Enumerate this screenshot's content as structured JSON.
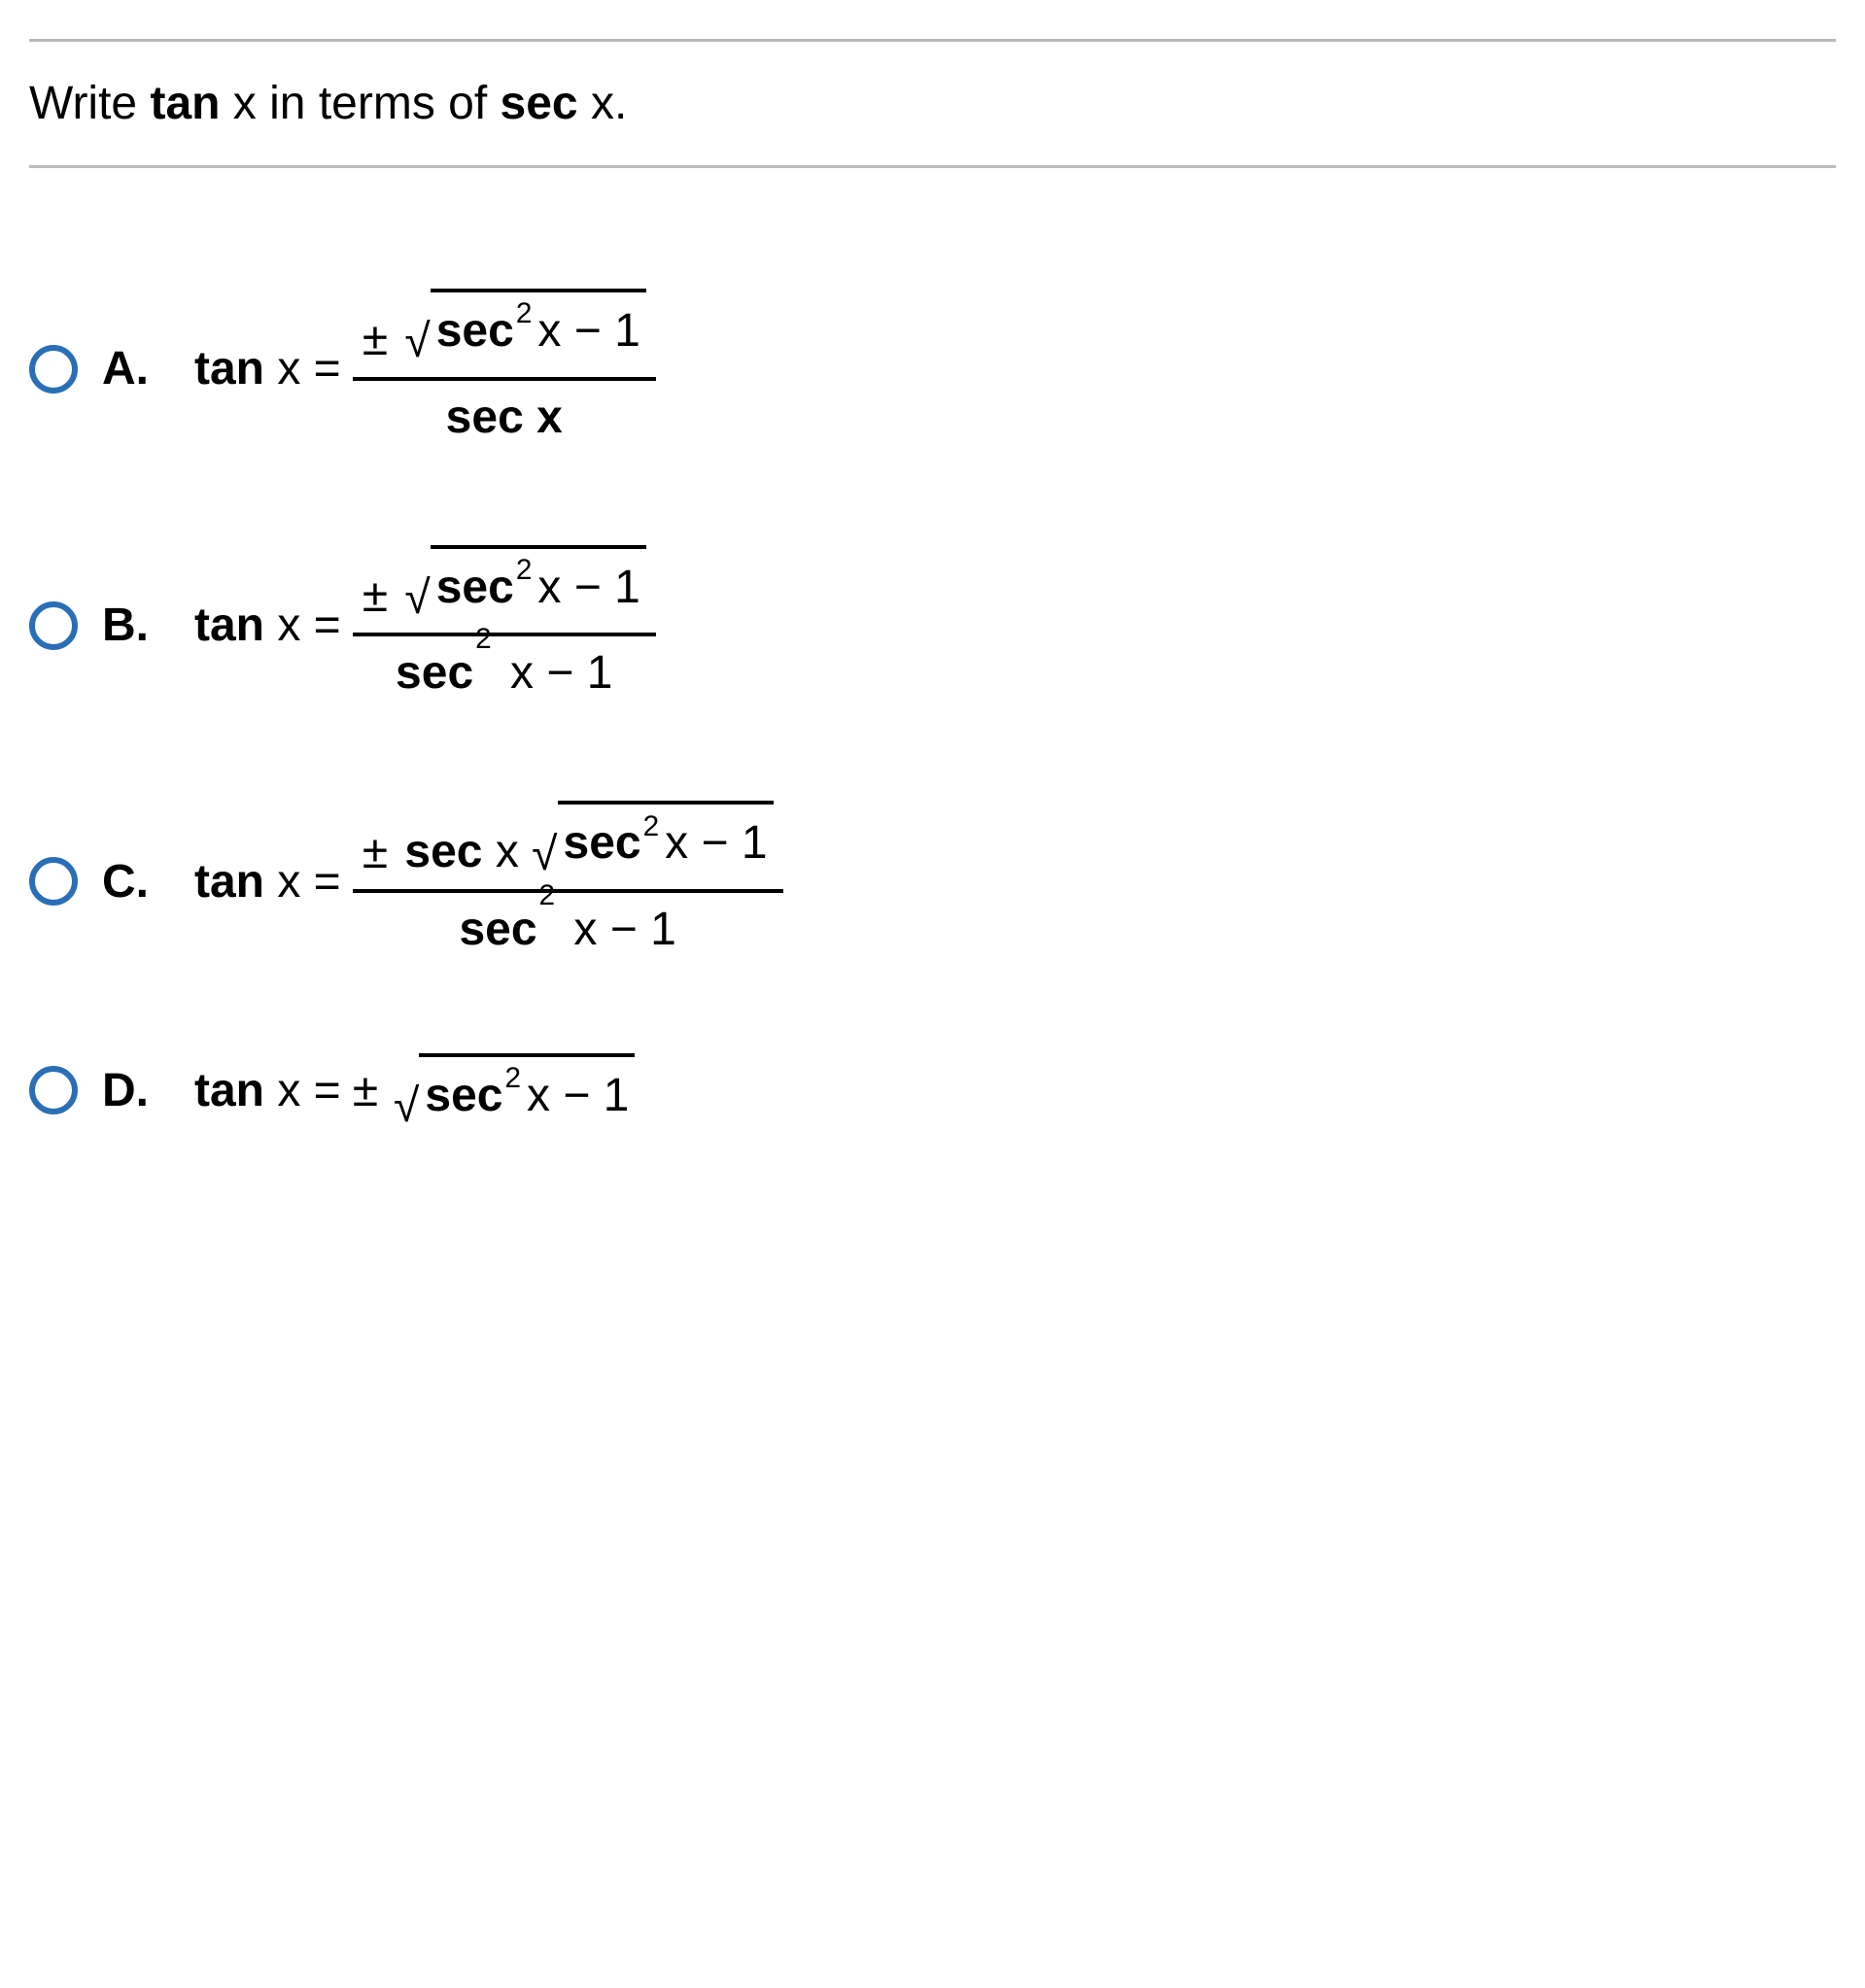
{
  "question": {
    "prefix": "Write ",
    "target": "tan",
    "mid": " x in terms of ",
    "given": "sec",
    "suffix": " x."
  },
  "labels": {
    "A": "A.",
    "B": "B.",
    "C": "C.",
    "D": "D."
  },
  "lhs": {
    "func": "tan",
    "var": " x = "
  },
  "sym": {
    "pm": "±",
    "minus1": " x − 1",
    "x": " x",
    "sec": "sec",
    "secx": "sec  x",
    "two": "2",
    "radical": "√"
  }
}
